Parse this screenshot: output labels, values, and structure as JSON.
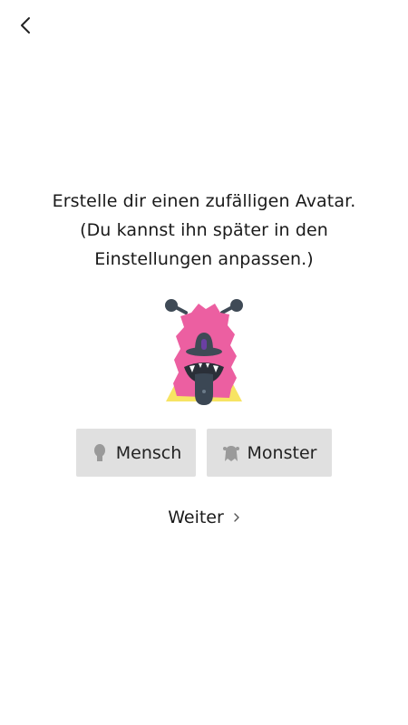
{
  "nav": {
    "back_icon": "chevron-left-icon"
  },
  "intro": {
    "line1": "Erstelle dir einen zufälligen Avatar.",
    "line2": "(Du kannst ihn später in den",
    "line3": "Einstellungen anpassen.)"
  },
  "avatar": {
    "icon": "pink-monster-avatar",
    "colors": {
      "fur": "#ec5fa1",
      "collar": "#f7e463",
      "dark": "#3f4a56",
      "tongue": "#2f3b47",
      "eye": "#6b3fa3"
    }
  },
  "choices": [
    {
      "label": "Mensch",
      "icon": "human-silhouette-icon"
    },
    {
      "label": "Monster",
      "icon": "monster-silhouette-icon"
    }
  ],
  "next": {
    "label": "Weiter",
    "icon": "chevron-right-icon"
  },
  "colors": {
    "button_bg": "#e0e0e0",
    "background": "#ffffff",
    "text": "#1a1a1a"
  }
}
